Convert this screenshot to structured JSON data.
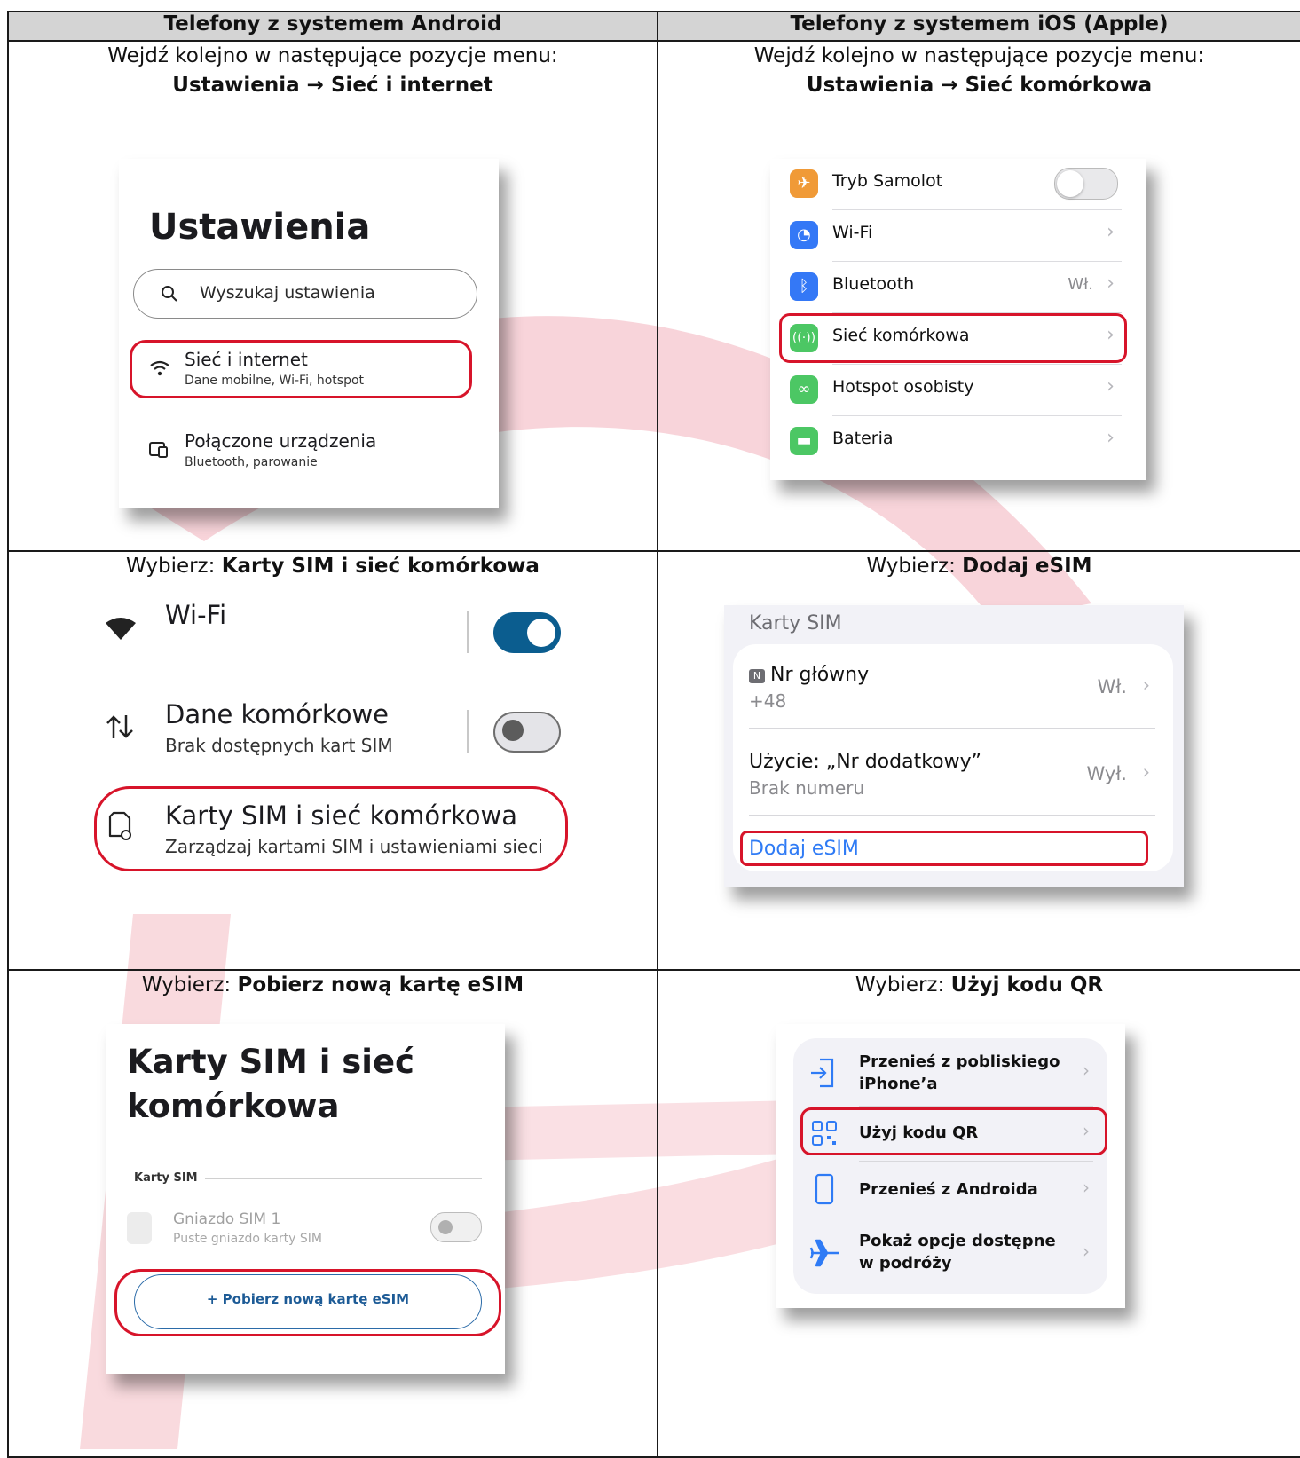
{
  "header": {
    "android": "Telefony z systemem Android",
    "ios": "Telefony z systemem iOS (Apple)"
  },
  "row1": {
    "android_line1": "Wejdź kolejno w następujące pozycje menu:",
    "android_line2": "Ustawienia → Sieć i internet",
    "ios_line1": "Wejdź kolejno w następujące pozycje menu:",
    "ios_line2": "Ustawienia → Sieć komórkowa"
  },
  "android_settings": {
    "title": "Ustawienia",
    "search_placeholder": "Wyszukaj ustawienia",
    "item1_title": "Sieć i internet",
    "item1_sub": "Dane mobilne, Wi-Fi, hotspot",
    "item2_title": "Połączone urządzenia",
    "item2_sub": "Bluetooth, parowanie"
  },
  "ios_settings": {
    "rows": [
      {
        "label": "Tryb Samolot",
        "value": "",
        "color": "#f09a37"
      },
      {
        "label": "Wi-Fi",
        "value": "",
        "color": "#3478f6"
      },
      {
        "label": "Bluetooth",
        "value": "Wł.",
        "color": "#3478f6"
      },
      {
        "label": "Sieć komórkowa",
        "value": "",
        "color": "#4cc764"
      },
      {
        "label": "Hotspot osobisty",
        "value": "",
        "color": "#4cc764"
      },
      {
        "label": "Bateria",
        "value": "",
        "color": "#4cc764"
      }
    ]
  },
  "row2": {
    "android_prefix": "Wybierz: ",
    "android_bold": "Karty SIM i sieć komórkowa",
    "ios_prefix": "Wybierz: ",
    "ios_bold": "Dodaj eSIM"
  },
  "android_network": {
    "wifi_label": "Wi-Fi",
    "wifi_on": true,
    "data_label": "Dane komórkowe",
    "data_sub": "Brak dostępnych kart SIM",
    "sim_label": "Karty SIM i sieć komórkowa",
    "sim_sub": "Zarządzaj kartami SIM i ustawieniami sieci",
    "accent": "#0b5d8f"
  },
  "ios_sim": {
    "header": "Karty SIM",
    "badge": "N",
    "primary_title": "Nr główny",
    "primary_number": "+48",
    "primary_value": "Wł.",
    "secondary_title": "Użycie: „Nr dodatkowy”",
    "secondary_sub": "Brak numeru",
    "secondary_value": "Wył.",
    "add_esim": "Dodaj eSIM",
    "link_color": "#2f7bf5"
  },
  "row3": {
    "android_prefix": "Wybierz: ",
    "android_bold": "Pobierz nową kartę eSIM",
    "ios_prefix": "Wybierz: ",
    "ios_bold": "Użyj kodu QR"
  },
  "android_sim_page": {
    "title_line1": "Karty SIM i sieć",
    "title_line2": "komórkowa",
    "section": "Karty SIM",
    "slot_title": "Gniazdo SIM 1",
    "slot_sub": "Puste gniazdo karty SIM",
    "download_button": "+ Pobierz nową kartę eSIM"
  },
  "ios_esim_options": {
    "opt1_line1": "Przenieś z pobliskiego",
    "opt1_line2": "iPhone’a",
    "opt2": "Użyj kodu QR",
    "opt3": "Przenieś z Androida",
    "opt4_line1": "Pokaż opcje dostępne",
    "opt4_line2": "w podróży"
  },
  "colors": {
    "highlight": "#d7142a",
    "watermark": "#f2bfc6",
    "header_bg": "#d4d4d4"
  }
}
